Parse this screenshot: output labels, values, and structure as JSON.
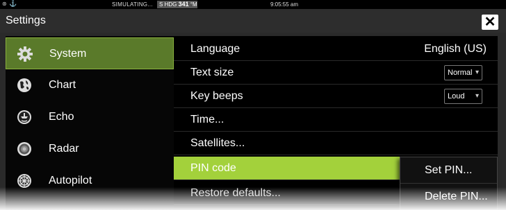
{
  "status": {
    "simulating": "SIMULATING...",
    "hdg_prefix": "S",
    "hdg_label": "HDG",
    "hdg_value": "341",
    "hdg_unit": "°M",
    "time": "9:05:55 am"
  },
  "title": "Settings",
  "menu": [
    {
      "label": "System",
      "icon": "gear-icon"
    },
    {
      "label": "Chart",
      "icon": "globe-icon"
    },
    {
      "label": "Echo",
      "icon": "echo-icon"
    },
    {
      "label": "Radar",
      "icon": "radar-icon"
    },
    {
      "label": "Autopilot",
      "icon": "helm-icon"
    }
  ],
  "settings": [
    {
      "label": "Language",
      "value": "English (US)"
    },
    {
      "label": "Text size",
      "value": "Normal"
    },
    {
      "label": "Key beeps",
      "value": "Loud"
    },
    {
      "label": "Time..."
    },
    {
      "label": "Satellites..."
    },
    {
      "label": "PIN code"
    },
    {
      "label": "Restore defaults..."
    }
  ],
  "popup": [
    {
      "label": "Set PIN..."
    },
    {
      "label": "Delete PIN..."
    }
  ],
  "colors": {
    "selected_menu": "#5a7a2a",
    "highlight_row": "#a3d13b"
  }
}
